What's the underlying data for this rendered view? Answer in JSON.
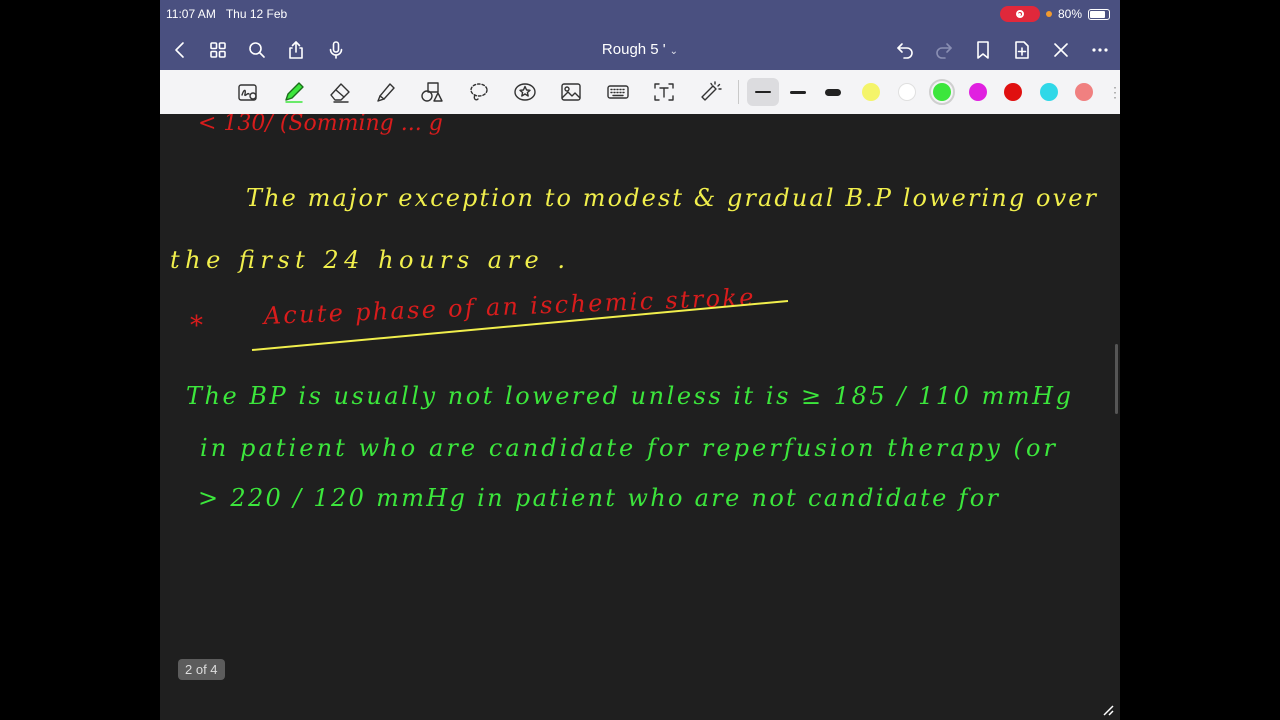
{
  "status_bar": {
    "time": "11:07 AM",
    "date": "Thu 12 Feb",
    "battery": "80%"
  },
  "nav": {
    "title": "Rough 5 '",
    "title_chevron": "⌄"
  },
  "toolbar": {
    "tools": [
      "handwriting-to-text",
      "pen",
      "eraser",
      "highlighter",
      "shapes",
      "lasso",
      "sticker",
      "image",
      "keyboard",
      "text",
      "laser-pointer"
    ],
    "stroke_sizes": [
      "thin",
      "medium",
      "thick"
    ],
    "colors": [
      "#f4f46a",
      "#ffffff",
      "#3ce63c",
      "#e020e0",
      "#e01010",
      "#30d8e8",
      "#f08080"
    ],
    "selected_color": "#3ce63c"
  },
  "note": {
    "line0_red": "< 130/ (Somming ... g",
    "yellow_lines": [
      "The major exception to modest & gradual B.P lowering over",
      "the first 24 hours are ."
    ],
    "red_heading_star": "*",
    "red_heading": "Acute phase of an ischemic stroke",
    "green_lines": [
      "The BP is usually not lowered unless it is ≥ 185 / 110 mmHg",
      "in patient who are candidate for reperfusion therapy (or",
      "> 220 / 120 mmHg in patient who are not candidate for"
    ]
  },
  "page_indicator": "2 of 4",
  "colors": {
    "ink_yellow": "#f1ef4c",
    "ink_green": "#3ce63c",
    "ink_red": "#d81c1c",
    "bar_blue": "#4a5080"
  }
}
